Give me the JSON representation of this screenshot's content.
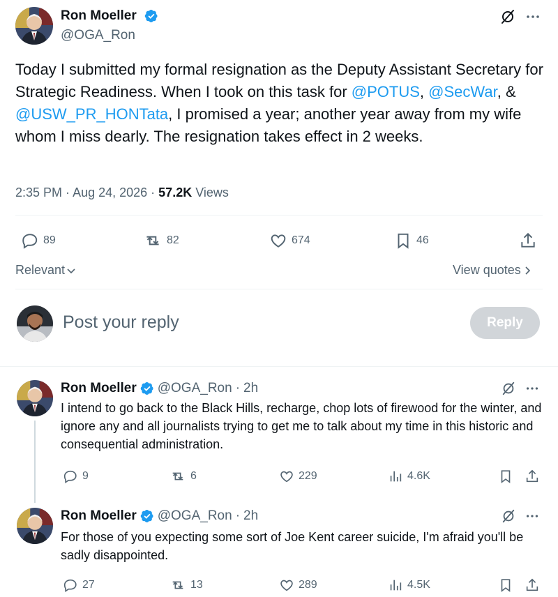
{
  "main_post": {
    "author_name": "Ron Moeller",
    "author_handle": "@OGA_Ron",
    "text_parts": [
      "Today I submitted my formal resignation as the Deputy Assistant Secretary for Strategic Readiness. When I took on this task for ",
      "@POTUS",
      ",",
      "@SecWar",
      ", & ",
      "@USW_PR_HONTata",
      ", I promised a year; another year away from my wife whom I miss dearly. The resignation takes effect in 2 weeks."
    ],
    "time": "2:35 PM",
    "date": "Aug 24, 2026",
    "views_count": "57.2K",
    "views_label": "Views",
    "replies": "89",
    "reposts": "82",
    "likes": "674",
    "bookmarks": "46"
  },
  "sort": {
    "label": "Relevant",
    "view_quotes": "View quotes"
  },
  "composer": {
    "placeholder": "Post your reply",
    "button_label": "Reply"
  },
  "replies": [
    {
      "author_name": "Ron Moeller",
      "author_handle": "@OGA_Ron",
      "age": "2h",
      "text": "I intend to go back to the Black Hills, recharge, chop lots of firewood for the winter, and ignore any and all journalists trying to get me to talk about my time in this historic and consequential administration.",
      "replies": "9",
      "reposts": "6",
      "likes": "229",
      "views": "4.6K"
    },
    {
      "author_name": "Ron Moeller",
      "author_handle": "@OGA_Ron",
      "age": "2h",
      "text": "For those of you expecting some sort of Joe Kent career suicide, I'm afraid you'll be sadly disappointed.",
      "replies": "27",
      "reposts": "13",
      "likes": "289",
      "views": "4.5K"
    }
  ],
  "colors": {
    "accent": "#1d9bf0",
    "muted": "#536471",
    "text": "#0f1419",
    "divider": "#eff3f4"
  },
  "icons": [
    "verified-badge-icon",
    "grok-icon",
    "more-icon",
    "reply-icon",
    "repost-icon",
    "like-icon",
    "bookmark-icon",
    "share-icon",
    "views-icon",
    "chevron-down-icon",
    "chevron-right-icon"
  ]
}
